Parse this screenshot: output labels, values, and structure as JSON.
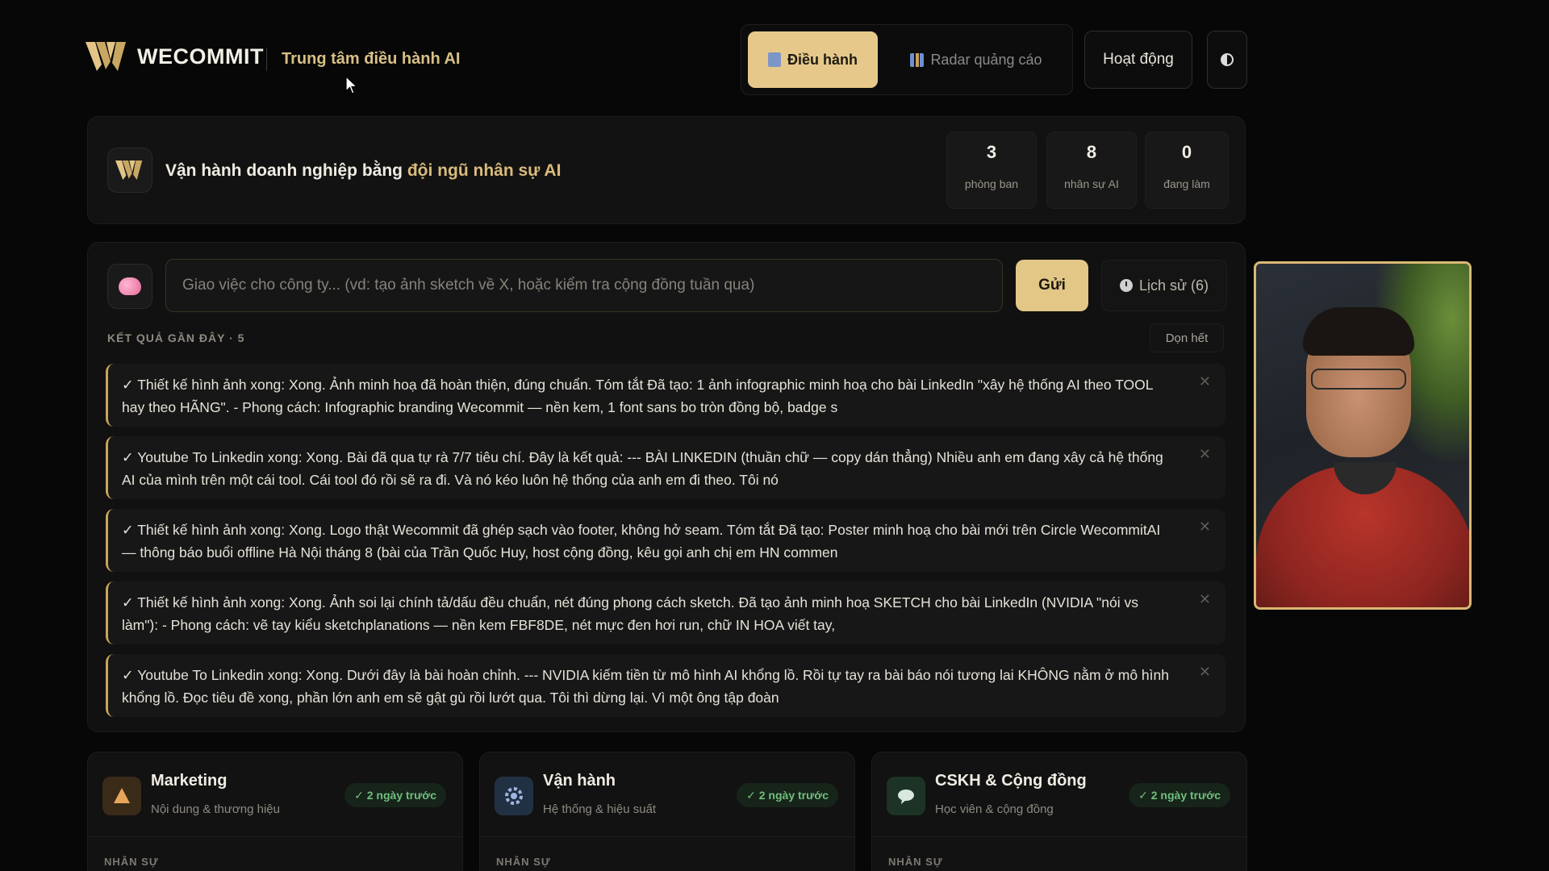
{
  "header": {
    "logo_text": "WECOMMIT",
    "subtitle": "Trung tâm điều hành AI",
    "tabs": [
      {
        "label": "Điều hành",
        "active": true,
        "icon": "document-icon"
      },
      {
        "label": "Radar quảng cáo",
        "active": false,
        "icon": "chart-icon"
      }
    ],
    "activity_label": "Hoạt động",
    "theme_icon": "theme-toggle-icon"
  },
  "hero": {
    "title_prefix": "Vận hành doanh nghiệp bằng",
    "title_accent": "đội ngũ nhân sự AI",
    "stats": [
      {
        "value": "3",
        "label": "phòng ban"
      },
      {
        "value": "8",
        "label": "nhân sự AI"
      },
      {
        "value": "0",
        "label": "đang làm"
      }
    ]
  },
  "command": {
    "placeholder": "Giao việc cho công ty... (vd: tạo ảnh sketch về X, hoặc kiểm tra cộng đồng tuần qua)",
    "value": "",
    "send_label": "Gửi",
    "history_label": "Lịch sử (6)",
    "results_heading": "KẾT QUẢ GẦN ĐÂY · 5",
    "clear_label": "Dọn hết",
    "results": [
      "✓ Thiết kế hình ảnh xong: Xong. Ảnh minh hoạ đã hoàn thiện, đúng chuẩn. Tóm tắt Đã tạo: 1 ảnh infographic minh hoạ cho bài LinkedIn \"xây hệ thống AI theo TOOL hay theo HÃNG\". - Phong cách: Infographic branding Wecommit — nền kem, 1 font sans bo tròn đồng bộ, badge s",
      "✓ Youtube To Linkedin xong: Xong. Bài đã qua tự rà 7/7 tiêu chí. Đây là kết quả: --- BÀI LINKEDIN (thuần chữ — copy dán thẳng) Nhiều anh em đang xây cả hệ thống AI của mình trên một cái tool. Cái tool đó rồi sẽ ra đi. Và nó kéo luôn hệ thống của anh em đi theo. Tôi nó",
      "✓ Thiết kế hình ảnh xong: Xong. Logo thật Wecommit đã ghép sạch vào footer, không hở seam. Tóm tắt Đã tạo: Poster minh hoạ cho bài mới trên Circle WecommitAI — thông báo buổi offline Hà Nội tháng 8 (bài của Trần Quốc Huy, host cộng đồng, kêu gọi anh chị em HN commen",
      "✓ Thiết kế hình ảnh xong: Xong. Ảnh soi lại chính tả/dấu đều chuẩn, nét đúng phong cách sketch. Đã tạo ảnh minh hoạ SKETCH cho bài LinkedIn (NVIDIA \"nói vs làm\"): - Phong cách: vẽ tay kiểu sketchplanations — nền kem FBF8DE, nét mực đen hơi run, chữ IN HOA viết tay,",
      "✓ Youtube To Linkedin xong: Xong. Dưới đây là bài hoàn chỉnh. --- NVIDIA kiếm tiền từ mô hình AI khổng lồ. Rồi tự tay ra bài báo nói tương lai KHÔNG nằm ở mô hình khổng lồ. Đọc tiêu đề xong, phần lớn anh em sẽ gật gù rồi lướt qua. Tôi thì dừng lại. Vì một ông tập đoàn"
    ],
    "close_glyph": "✕"
  },
  "departments": [
    {
      "name": "Marketing",
      "desc": "Nội dung & thương hiệu",
      "badge": "✓ 2 ngày trước",
      "section": "NHÂN SỰ",
      "icon": "megaphone-icon",
      "icon_color": "#e8a55a"
    },
    {
      "name": "Vận hành",
      "desc": "Hệ thống & hiệu suất",
      "badge": "✓ 2 ngày trước",
      "section": "NHÂN SỰ",
      "icon": "gear-icon",
      "icon_color": "#7f9fd6"
    },
    {
      "name": "CSKH & Cộng đồng",
      "desc": "Học viên & cộng đồng",
      "badge": "✓ 2 ngày trước",
      "section": "NHÂN SỰ",
      "icon": "chat-bubble-icon",
      "icon_color": "#6fbf8a"
    }
  ],
  "colors": {
    "accent": "#e3c787",
    "background": "#070707",
    "card": "#121212",
    "success": "#6fbf7d"
  }
}
